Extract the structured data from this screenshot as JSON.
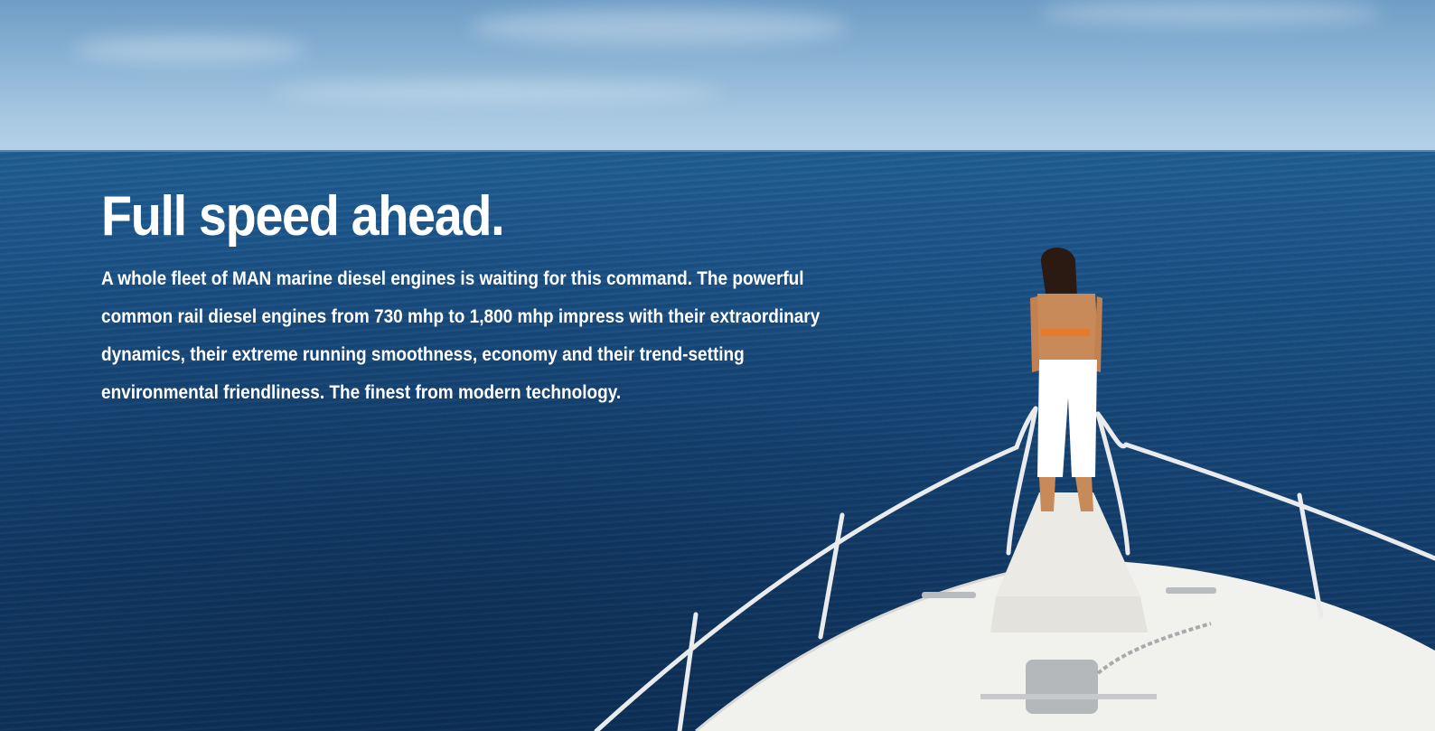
{
  "hero": {
    "headline": "Full speed ahead.",
    "body": "A whole fleet of MAN marine diesel engines is waiting for this command. The powerful common rail diesel engines from 730 mhp to 1,800 mhp impress with their extraordinary dynamics, their extreme running smoothness, economy and their trend-setting environmental friendliness. The finest from modern technology."
  },
  "colors": {
    "text": "#ffffff",
    "sea": "#154677",
    "sky": "#a9c9e2",
    "hull": "#f2f2ef"
  }
}
